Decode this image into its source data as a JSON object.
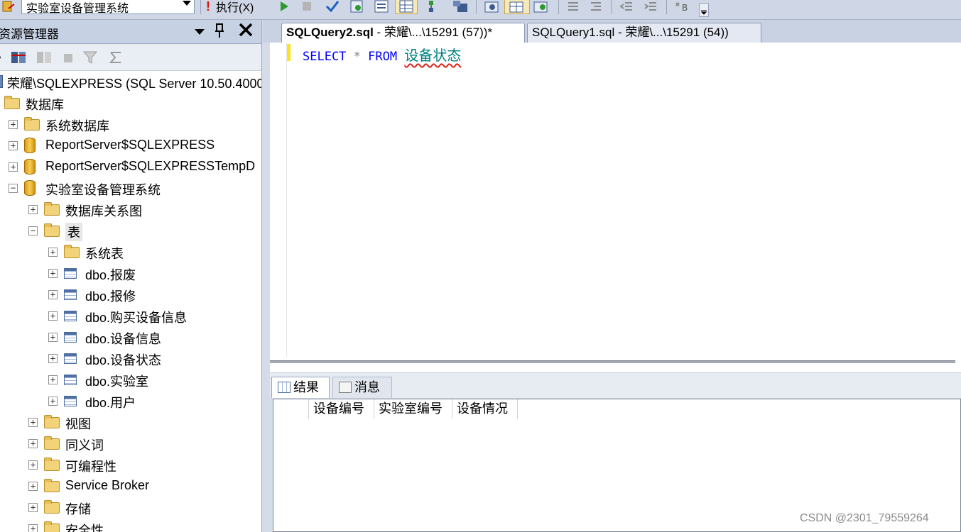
{
  "toolbar": {
    "database_select": "实验室设备管理系统",
    "execute_label": "执行(X)",
    "icons": [
      "database-icon",
      "execute-icon",
      "run-icon",
      "stop-icon",
      "parse-check-icon",
      "query-options-icon",
      "results-to-text-icon",
      "results-to-grid-icon",
      "include-plan-icon",
      "client-stats-icon",
      "comment-icon",
      "uncomment-icon",
      "decrease-indent-icon",
      "increase-indent-icon",
      "specify-values-icon"
    ]
  },
  "object_explorer": {
    "title": "资源管理器",
    "tools": [
      "connect-icon",
      "disconnect-icon",
      "stop-icon",
      "filter-icon",
      "refresh-icon"
    ],
    "tree": [
      {
        "label": "荣耀\\SQLEXPRESS (SQL Server 10.50.4000",
        "level": 0,
        "type": "server",
        "expander": ""
      },
      {
        "label": "数据库",
        "level": 0,
        "type": "folder",
        "expander": ""
      },
      {
        "label": "系统数据库",
        "level": 1,
        "type": "folder",
        "expander": "+"
      },
      {
        "label": "ReportServer$SQLEXPRESS",
        "level": 1,
        "type": "db",
        "expander": "+"
      },
      {
        "label": "ReportServer$SQLEXPRESSTempD",
        "level": 1,
        "type": "db",
        "expander": "+"
      },
      {
        "label": "实验室设备管理系统",
        "level": 1,
        "type": "db",
        "expander": "−"
      },
      {
        "label": "数据库关系图",
        "level": 2,
        "type": "folder",
        "expander": "+"
      },
      {
        "label": "表",
        "level": 2,
        "type": "folder",
        "expander": "−"
      },
      {
        "label": "系统表",
        "level": 3,
        "type": "folder",
        "expander": "+"
      },
      {
        "label": "dbo.报废",
        "level": 3,
        "type": "table",
        "expander": "+"
      },
      {
        "label": "dbo.报修",
        "level": 3,
        "type": "table",
        "expander": "+"
      },
      {
        "label": "dbo.购买设备信息",
        "level": 3,
        "type": "table",
        "expander": "+"
      },
      {
        "label": "dbo.设备信息",
        "level": 3,
        "type": "table",
        "expander": "+"
      },
      {
        "label": "dbo.设备状态",
        "level": 3,
        "type": "table",
        "expander": "+"
      },
      {
        "label": "dbo.实验室",
        "level": 3,
        "type": "table",
        "expander": "+"
      },
      {
        "label": "dbo.用户",
        "level": 3,
        "type": "table",
        "expander": "+"
      },
      {
        "label": "视图",
        "level": 2,
        "type": "folder",
        "expander": "+"
      },
      {
        "label": "同义词",
        "level": 2,
        "type": "folder",
        "expander": "+"
      },
      {
        "label": "可编程性",
        "level": 2,
        "type": "folder",
        "expander": "+"
      },
      {
        "label": "Service Broker",
        "level": 2,
        "type": "folder",
        "expander": "+"
      },
      {
        "label": "存储",
        "level": 2,
        "type": "folder",
        "expander": "+"
      },
      {
        "label": "安全性",
        "level": 2,
        "type": "folder",
        "expander": "+"
      }
    ]
  },
  "editor": {
    "tabs": [
      {
        "name": "SQLQuery2.sql",
        "rest": " - 荣耀\\...\\15291 (57))*"
      },
      {
        "name": "SQLQuery1.sql - 荣耀\\...\\15291 (54))"
      }
    ],
    "code": {
      "keyword1": "SELECT",
      "star": "*",
      "keyword2": "FROM",
      "object": "设备状态"
    }
  },
  "results": {
    "tabs": [
      "结果",
      "消息"
    ],
    "columns": [
      "设备编号",
      "实验室编号",
      "设备情况"
    ]
  },
  "watermark": "CSDN @2301_79559264",
  "colors": {
    "keyword": "#0000ff",
    "object": "#008080",
    "change_bar": "#ffe31a",
    "panel_header": "#c7d1e4"
  }
}
